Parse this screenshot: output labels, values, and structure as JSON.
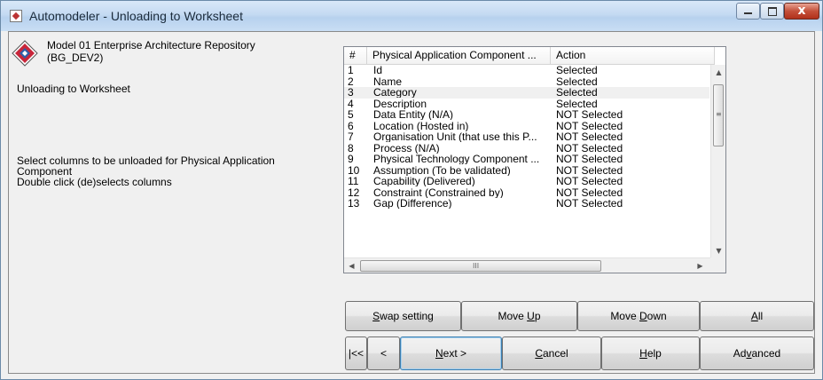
{
  "window": {
    "title": "Automodeler - Unloading to Worksheet",
    "controls": {
      "minimize": "–",
      "maximize": "□",
      "close": "x"
    }
  },
  "left_panel": {
    "repo_line1": "Model 01 Enterprise Architecture Repository",
    "repo_line2": "(BG_DEV2)",
    "mode": "Unloading to Worksheet",
    "instruction_line1": "Select columns to be unloaded for Physical Application",
    "instruction_line2": "Component",
    "instruction_line3": "Double click (de)selects columns"
  },
  "listview": {
    "columns": [
      "#",
      "Physical Application Component ...",
      "Action"
    ],
    "rows": [
      {
        "num": "1",
        "name": "Id",
        "action": "Selected"
      },
      {
        "num": "2",
        "name": "Name",
        "action": "Selected"
      },
      {
        "num": "3",
        "name": "Category",
        "action": "Selected"
      },
      {
        "num": "4",
        "name": "Description",
        "action": "Selected"
      },
      {
        "num": "5",
        "name": "Data Entity (N/A)",
        "action": "NOT Selected"
      },
      {
        "num": "6",
        "name": "Location (Hosted in)",
        "action": "NOT Selected"
      },
      {
        "num": "7",
        "name": "Organisation Unit (that use this P...",
        "action": "NOT Selected"
      },
      {
        "num": "8",
        "name": "Process (N/A)",
        "action": "NOT Selected"
      },
      {
        "num": "9",
        "name": "Physical Technology Component ...",
        "action": "NOT Selected"
      },
      {
        "num": "10",
        "name": "Assumption (To be validated)",
        "action": "NOT Selected"
      },
      {
        "num": "11",
        "name": "Capability (Delivered)",
        "action": "NOT Selected"
      },
      {
        "num": "12",
        "name": "Constraint (Constrained by)",
        "action": "NOT Selected"
      },
      {
        "num": "13",
        "name": "Gap (Difference)",
        "action": "NOT Selected"
      }
    ],
    "scroll": {
      "up": "▲",
      "down": "▼",
      "left": "◀",
      "right": "▶",
      "grip_v": "≡",
      "grip_h": "III"
    }
  },
  "buttons": {
    "swap": {
      "pre": "",
      "key": "S",
      "post": "wap setting"
    },
    "move_up": {
      "pre": "Move ",
      "key": "U",
      "post": "p"
    },
    "move_down": {
      "pre": "Move ",
      "key": "D",
      "post": "own"
    },
    "all": {
      "pre": "",
      "key": "A",
      "post": "ll"
    },
    "first": "|<<",
    "prev": "<",
    "next": {
      "pre": "",
      "key": "N",
      "post": "ext >"
    },
    "cancel": {
      "pre": "",
      "key": "C",
      "post": "ancel"
    },
    "help": {
      "pre": "",
      "key": "H",
      "post": "elp"
    },
    "advanced": {
      "pre": "Ad",
      "key": "v",
      "post": "anced"
    }
  }
}
